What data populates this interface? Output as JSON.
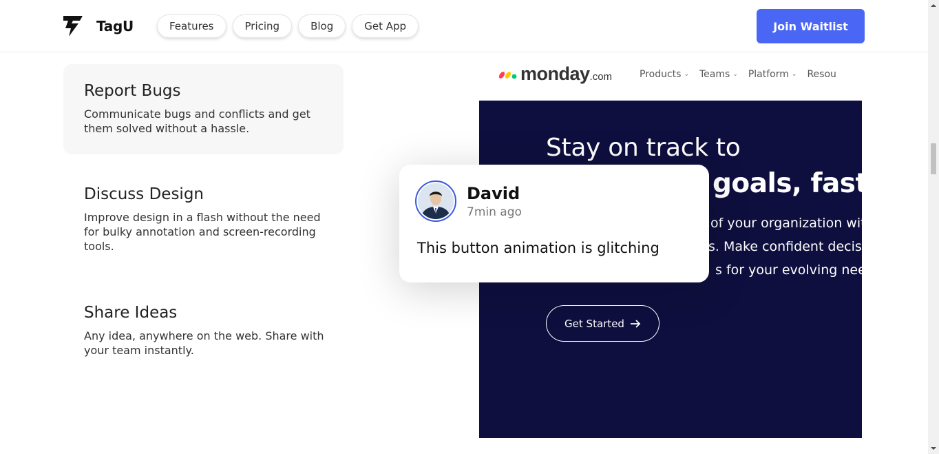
{
  "header": {
    "brand": "TagU",
    "nav": [
      "Features",
      "Pricing",
      "Blog",
      "Get App"
    ],
    "cta": "Join Waitlist"
  },
  "features": [
    {
      "title": "Report Bugs",
      "description": "Communicate bugs and conflicts and get them solved without a hassle.",
      "active": true
    },
    {
      "title": "Discuss Design",
      "description": "Improve design in a flash without the need for bulky annotation and screen-recording tools.",
      "active": false
    },
    {
      "title": "Share Ideas",
      "description": "Any idea, anywhere on the web. Share with your team instantly.",
      "active": false
    }
  ],
  "mockup": {
    "logo_word": "monday",
    "logo_suffix": ".com",
    "nav": [
      "Products",
      "Teams",
      "Platform",
      "Resou"
    ],
    "hero_line1": "Stay on track to",
    "hero_line2": "goals, faster",
    "hero_text": [
      "of your organization wit",
      "s. Make confident decisi",
      "s for your evolving need"
    ],
    "button": "Get Started",
    "hero_bg": "#0f0f3f"
  },
  "comment": {
    "name": "David",
    "time": "7min ago",
    "message": "This button animation is glitching",
    "avatar_icon": "user-avatar"
  },
  "colors": {
    "accent": "#4a66f5",
    "feature_active_bg": "#f7f7f7"
  }
}
